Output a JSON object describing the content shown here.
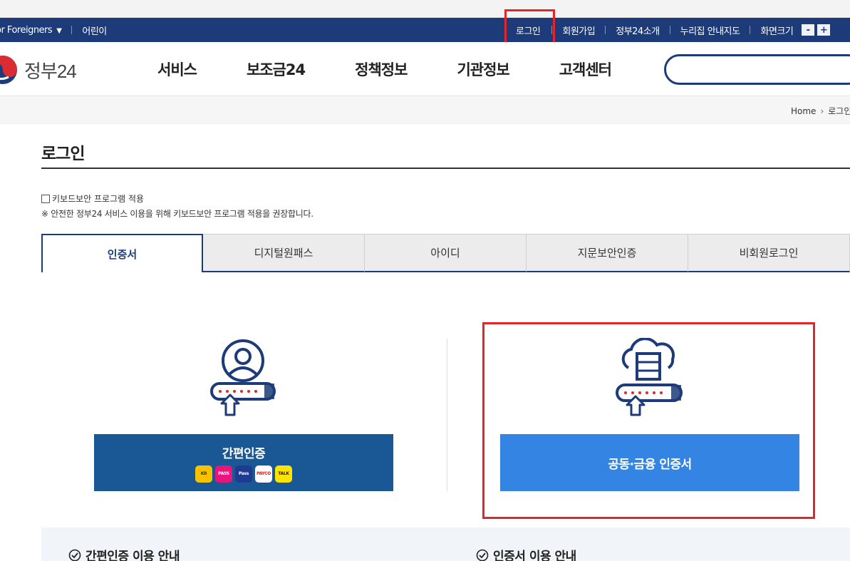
{
  "topbar": {
    "for_foreigners": "or Foreigners",
    "kids": "어린이",
    "login": "로그인",
    "signup": "회원가입",
    "about": "정부24소개",
    "sitemap": "누리집 안내지도",
    "zoom_label": "화면크기",
    "zoom_minus": "-",
    "zoom_plus": "+"
  },
  "header": {
    "logo_text": "정부24",
    "menu": [
      "서비스",
      "보조금24",
      "정책정보",
      "기관정보",
      "고객센터"
    ]
  },
  "breadcrumb": {
    "home": "Home",
    "current": "로그인"
  },
  "page": {
    "title": "로그인",
    "keyboard_security_label": "키보드보안 프로그램 적용",
    "keyboard_security_note": "※ 안전한 정부24 서비스 이용을 위해 키보드보안 프로그램 적용을 권장합니다."
  },
  "tabs": [
    "인증서",
    "디지털원패스",
    "아이디",
    "지문보안인증",
    "비회원로그인"
  ],
  "auth": {
    "simple_button": "간편인증",
    "cert_button": "공동·금융 인증서",
    "providers": [
      {
        "name": "KB",
        "bg": "#f7c300",
        "fg": "#4a3b00"
      },
      {
        "name": "PASS",
        "bg": "#e8167c",
        "fg": "#ffffff"
      },
      {
        "name": "Pass",
        "bg": "#1f3b8f",
        "fg": "#ffffff"
      },
      {
        "name": "PAYCO",
        "bg": "#ffffff",
        "fg": "#e2231a"
      },
      {
        "name": "TALK",
        "bg": "#fee500",
        "fg": "#3a1d1d"
      }
    ]
  },
  "guide": {
    "simple_guide": "간편인증 이용 안내",
    "cert_guide": "인증서 이용 안내"
  },
  "colors": {
    "navy": "#1c3b78",
    "primary_blue": "#3484e3",
    "dark_blue": "#1a5795",
    "highlight_red": "#e3262c"
  }
}
